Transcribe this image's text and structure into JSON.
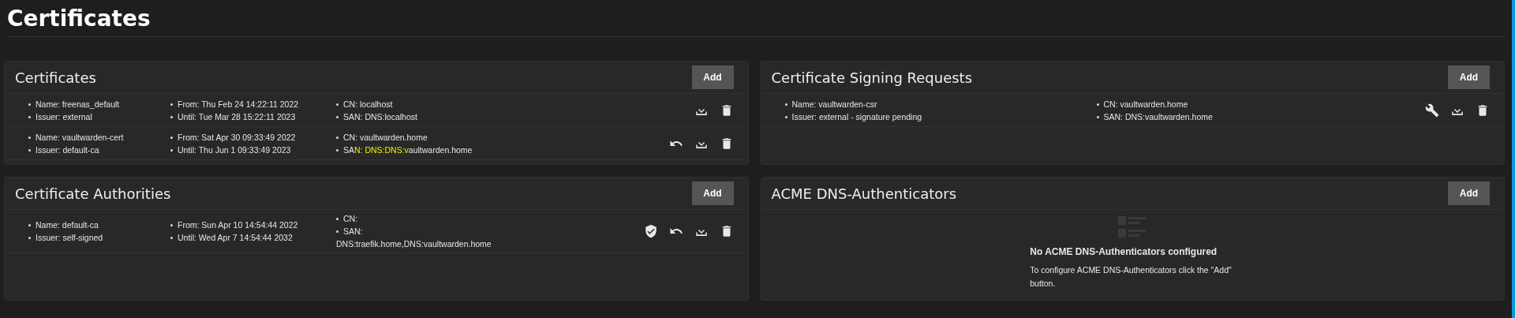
{
  "page": {
    "title": "Certificates"
  },
  "cards": [
    {
      "title": "Certificates",
      "add_button": "Add",
      "rows": [
        {
          "kind": "certificate",
          "columns": [
            [
              {
                "text": "Name: freenas_default"
              },
              {
                "text": "Issuer: external"
              }
            ],
            [
              {
                "text": "From: Thu Feb 24 14:22:11 2022"
              },
              {
                "text": "Until: Tue Mar 28 15:22:11 2023"
              }
            ],
            [
              {
                "text": "CN: localhost"
              },
              {
                "text": "SAN: DNS:localhost"
              }
            ]
          ]
        },
        {
          "kind": "revocable_certificate",
          "columns": [
            [
              {
                "text": "Name: vaultwarden-cert"
              },
              {
                "text": "Issuer: default-ca"
              }
            ],
            [
              {
                "text": "From: Sat Apr 30 09:33:49 2022"
              },
              {
                "text": "Until: Thu Jun 1 09:33:49 2023"
              }
            ],
            [
              {
                "text": "CN: vaultwarden.home"
              },
              {
                "segments": [
                  {
                    "text": "SA",
                    "highlighted": false
                  },
                  {
                    "text": "N: DNS:DNS:v",
                    "highlighted": true
                  },
                  {
                    "text": "aultwarden.home",
                    "highlighted": false
                  }
                ]
              }
            ]
          ]
        }
      ]
    },
    {
      "title": "Certificate Signing Requests",
      "add_button": "Add",
      "rows": [
        {
          "kind": "csr",
          "columns": [
            [
              {
                "text": "Name: vaultwarden-csr"
              },
              {
                "text": "Issuer: external - signature pending"
              }
            ],
            [
              {
                "text": "CN: vaultwarden.home"
              },
              {
                "text": "SAN: DNS:vaultwarden.home"
              }
            ]
          ]
        }
      ]
    },
    {
      "title": "Certificate Authorities",
      "add_button": "Add",
      "rows": [
        {
          "kind": "authority",
          "columns": [
            [
              {
                "text": "Name: default-ca"
              },
              {
                "text": "Issuer: self-signed"
              }
            ],
            [
              {
                "text": "From: Sun Apr 10 14:54:44 2022"
              },
              {
                "text": "Until: Wed Apr 7 14:54:44 2032"
              }
            ],
            [
              {
                "text": "CN:"
              },
              {
                "text": "SAN:",
                "continuation": "DNS:traefik.home,DNS:vaultwarden.home"
              }
            ]
          ]
        }
      ]
    },
    {
      "title": "ACME DNS-Authenticators",
      "add_button": "Add",
      "empty_state": {
        "title": "No ACME DNS-Authenticators configured",
        "message": "To configure ACME DNS-Authenticators click the \"Add\" button."
      }
    }
  ]
}
